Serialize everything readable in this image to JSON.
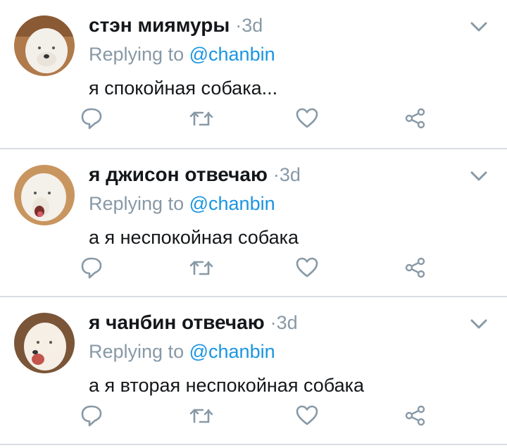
{
  "tweets": [
    {
      "name": "стэн миямуры",
      "time": "·3d",
      "reply_prefix": "Replying to",
      "reply_handle": "@chanbin",
      "text": "я спокойная собака..."
    },
    {
      "name": "я джисон отвечаю",
      "time": "·3d",
      "reply_prefix": "Replying to",
      "reply_handle": "@chanbin",
      "text": "а я неспокойная собака"
    },
    {
      "name": "я чанбин отвечаю",
      "time": "·3d",
      "reply_prefix": "Replying to",
      "reply_handle": "@chanbin",
      "text": "а я вторая неспокойная собака"
    }
  ],
  "icons": {
    "reply": "reply-icon",
    "retweet": "retweet-icon",
    "like": "heart-icon",
    "share": "share-icon",
    "menu": "chevron-down-icon"
  },
  "colors": {
    "link": "#1b95e0",
    "secondary": "#8899a6",
    "text": "#14171a",
    "divider": "#d9dde1"
  }
}
